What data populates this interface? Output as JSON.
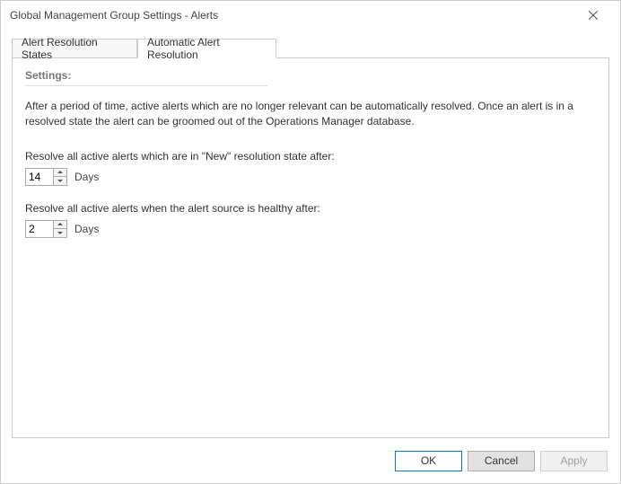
{
  "window": {
    "title": "Global Management Group Settings - Alerts"
  },
  "tabs": {
    "resolution_states": "Alert Resolution States",
    "auto_resolution": "Automatic Alert Resolution"
  },
  "settings": {
    "header": "Settings:",
    "description": "After a period of time, active alerts which are no longer relevant can be automatically resolved. Once an alert is in a resolved state the alert can be groomed out of the Operations Manager database.",
    "new_state_label": "Resolve all active alerts which are in \"New\" resolution state after:",
    "new_state_value": "14",
    "new_state_unit": "Days",
    "healthy_label": "Resolve all active alerts when the alert source is healthy after:",
    "healthy_value": "2",
    "healthy_unit": "Days"
  },
  "buttons": {
    "ok": "OK",
    "cancel": "Cancel",
    "apply": "Apply"
  }
}
